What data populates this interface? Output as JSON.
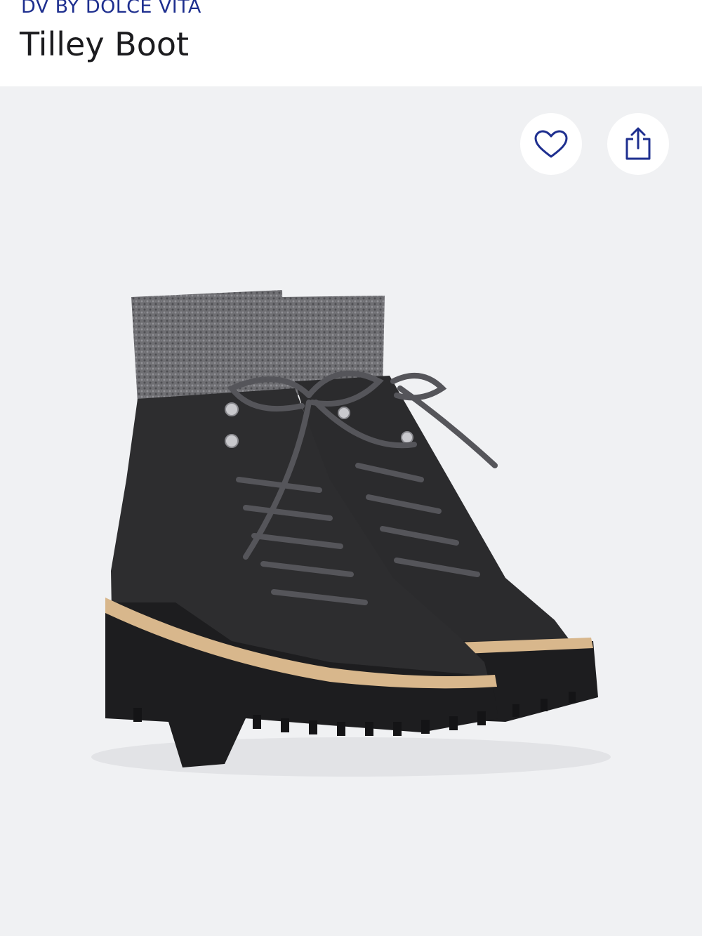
{
  "product": {
    "brand": "DV BY DOLCE VITA",
    "name": "Tilley Boot"
  },
  "actions": {
    "favorite_icon": "heart-icon",
    "share_icon": "share-icon"
  },
  "image": {
    "subject": "product-photo",
    "colors": {
      "background": "#f0f1f3",
      "leather": "#2a2a2c",
      "sole": "#1d1d1f",
      "welt": "#d8b78c",
      "sock_knit": "#6e6e72",
      "laces": "#55555a"
    }
  },
  "theme": {
    "brand_color": "#1e2f8f",
    "title_color": "#1c1c1f",
    "icon_color": "#1e2f8f"
  }
}
